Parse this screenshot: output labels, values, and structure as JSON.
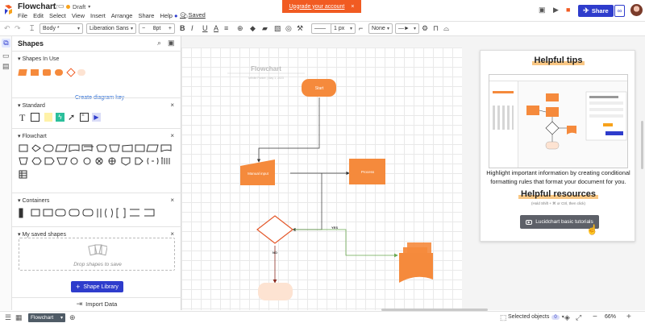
{
  "app": {
    "title": "Flowchart",
    "status": "Draft",
    "saved": "Saved",
    "menu": [
      "File",
      "Edit",
      "Select",
      "View",
      "Insert",
      "Arrange",
      "Share",
      "Help"
    ],
    "upgrade_label": "Upgrade your account",
    "upgrade_close": "×",
    "share_label": "Share",
    "accent": "#2e3ccc",
    "brand_orange": "#f15b22"
  },
  "toolbar": {
    "style_select": "Body *",
    "font_select": "Liberation Sans",
    "font_size": "8pt",
    "line_width": "1 px",
    "arrow_start": "None"
  },
  "panel": {
    "title": "Shapes",
    "sections": {
      "in_use": "Shapes In Use",
      "standard": "Standard",
      "flowchart": "Flowchart",
      "containers": "Containers",
      "saved": "My saved shapes"
    },
    "create_key": "Create diagram key",
    "drop_text": "Drop shapes to save",
    "shape_library": "Shape Library",
    "import_data": "Import Data",
    "close": "×"
  },
  "canvas": {
    "diagram_title": "Flowchart",
    "diagram_subtitle": "Infinite Parker  |  May 1, 2023",
    "nodes": {
      "start": "Start",
      "manual_input": "Manual input",
      "process": "Process",
      "yes": "YES",
      "no": "NO"
    },
    "shape_fill": "#f58a3c",
    "shape_light": "#fde3d2",
    "connector_green": "#6aa84f"
  },
  "tips": {
    "title": "Helpful tips",
    "body": "Highlight important information by creating conditional formatting rules that format your document for you.",
    "resources_title": "Helpful resources",
    "resources_hint": "(Hold Shift + ⌘ or Ctrl, then click)",
    "video_label": "Lucidchart basic tutorials"
  },
  "footer": {
    "page_tab": "Flowchart",
    "selected_objects": "Selected objects",
    "selected_count": "0",
    "zoom": "66%"
  }
}
